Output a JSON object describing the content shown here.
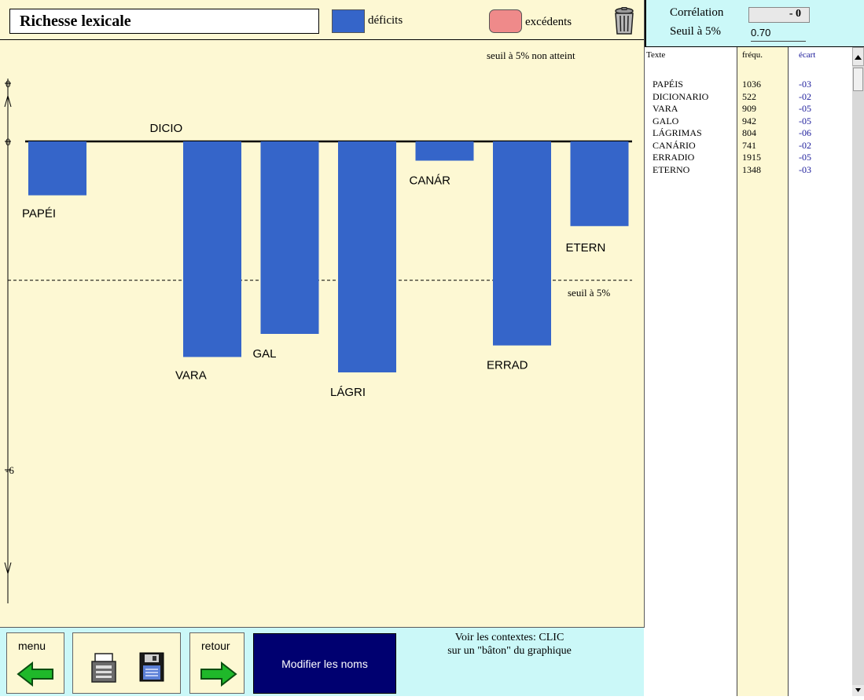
{
  "header": {
    "title": "Richesse lexicale",
    "legend_deficit": "déficits",
    "legend_excess": "excédents",
    "deficit_color": "#3565c9",
    "excess_color": "#ef8a8a",
    "trash_icon": "trash-can-icon"
  },
  "threshold_note": "seuil à 5% non atteint",
  "chart_data": {
    "type": "bar",
    "categories": [
      "PAPÉI",
      "DICIO",
      "VARA",
      "GAL",
      "LÁGRI",
      "CANÁR",
      "ERRAD",
      "ETERN"
    ],
    "values": [
      -3,
      -2,
      -5,
      -5,
      -6,
      -2,
      -5,
      -3
    ],
    "bar_heights": [
      -1.4,
      0,
      -5.6,
      -5.0,
      -6.0,
      -0.5,
      -5.3,
      -2.2
    ],
    "y_ticks": [
      "0",
      "0",
      "-6"
    ],
    "ylim": [
      -10,
      1.3
    ],
    "threshold_label": "seuil à 5%",
    "threshold_value": -3.2,
    "bar_color": "#3565c9"
  },
  "correlation": {
    "label": "Corrélation",
    "value": "-   0",
    "seuil_label": "Seuil à 5%",
    "seuil_value": "0.70"
  },
  "table": {
    "headers": {
      "text": "Texte",
      "freq": "fréqu.",
      "ecart": "écart"
    },
    "rows": [
      {
        "word": "PAPÉIS",
        "freq": "1036",
        "ecart": "-03"
      },
      {
        "word": "DICIONARIO",
        "freq": "522",
        "ecart": "-02"
      },
      {
        "word": "VARA",
        "freq": "909",
        "ecart": "-05"
      },
      {
        "word": "GALO",
        "freq": "942",
        "ecart": "-05"
      },
      {
        "word": "LÁGRIMAS",
        "freq": "804",
        "ecart": "-06"
      },
      {
        "word": "CANÁRIO",
        "freq": "741",
        "ecart": "-02"
      },
      {
        "word": "ERRADIO",
        "freq": "1915",
        "ecart": "-05"
      },
      {
        "word": "ETERNO",
        "freq": "1348",
        "ecart": "-03"
      }
    ]
  },
  "toolbar": {
    "menu_label": "menu",
    "retour_label": "retour",
    "modify_label": "Modifier les noms",
    "hint_line1": "Voir les contextes: CLIC",
    "hint_line2": "sur un \"bâton\" du graphique"
  }
}
